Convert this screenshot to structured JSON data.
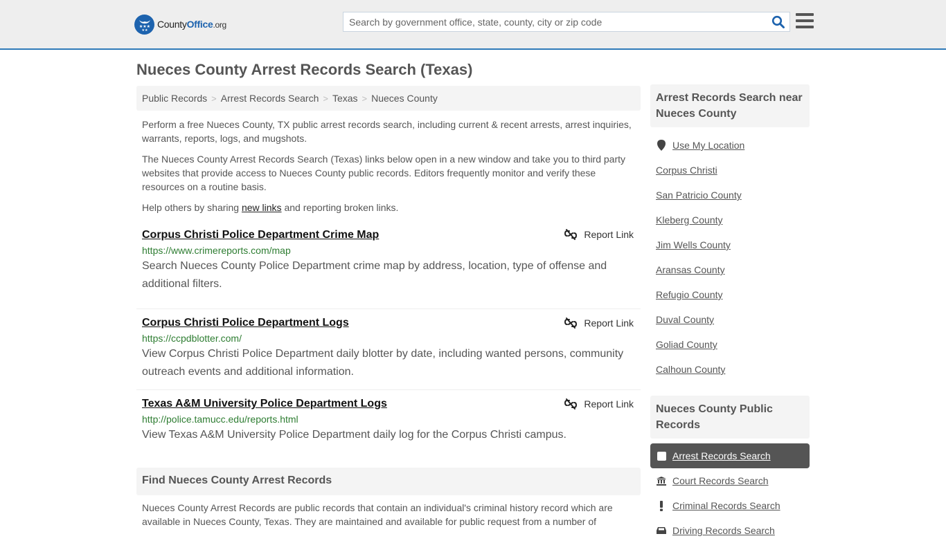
{
  "header": {
    "logo": {
      "brand_a": "County",
      "brand_b": "Office",
      "brand_c": ".org"
    },
    "search": {
      "placeholder": "Search by government office, state, county, city or zip code",
      "value": ""
    },
    "icons": {
      "search": "search-icon",
      "menu": "hamburger-menu-icon"
    }
  },
  "page": {
    "title": "Nueces County Arrest Records Search (Texas)"
  },
  "breadcrumb": [
    {
      "label": "Public Records"
    },
    {
      "label": "Arrest Records Search"
    },
    {
      "label": "Texas"
    },
    {
      "label": "Nueces County"
    }
  ],
  "breadcrumb_separator": ">",
  "intro": {
    "p1": "Perform a free Nueces County, TX public arrest records search, including current & recent arrests, arrest inquiries, warrants, reports, logs, and mugshots.",
    "p2": "The Nueces County Arrest Records Search (Texas) links below open in a new window and take you to third party websites that provide access to Nueces County public records. Editors frequently monitor and verify these resources on a routine basis.",
    "p3_before": "Help others by sharing ",
    "p3_link": "new links",
    "p3_after": " and reporting broken links."
  },
  "results": [
    {
      "title": "Corpus Christi Police Department Crime Map",
      "url": "https://www.crimereports.com/map",
      "description": "Search Nueces County Police Department crime map by address, location, type of offense and additional filters.",
      "report_label": "Report Link"
    },
    {
      "title": "Corpus Christi Police Department Logs",
      "url": "https://ccpdblotter.com/",
      "description": "View Corpus Christi Police Department daily blotter by date, including wanted persons, community outreach events and additional information.",
      "report_label": "Report Link"
    },
    {
      "title": "Texas A&M University Police Department Logs",
      "url": "http://police.tamucc.edu/reports.html",
      "description": "View Texas A&M University Police Department daily log for the Corpus Christi campus.",
      "report_label": "Report Link"
    }
  ],
  "find": {
    "heading": "Find Nueces County Arrest Records",
    "text": "Nueces County Arrest Records are public records that contain an individual's criminal history record which are available in Nueces County, Texas. They are maintained and available for public request from a number of"
  },
  "sidebar": {
    "nearby": {
      "heading": "Arrest Records Search near Nueces County",
      "location_label": "Use My Location",
      "items": [
        {
          "label": "Corpus Christi"
        },
        {
          "label": "San Patricio County"
        },
        {
          "label": "Kleberg County"
        },
        {
          "label": "Jim Wells County"
        },
        {
          "label": "Aransas County"
        },
        {
          "label": "Refugio County"
        },
        {
          "label": "Duval County"
        },
        {
          "label": "Goliad County"
        },
        {
          "label": "Calhoun County"
        }
      ]
    },
    "public_records": {
      "heading": "Nueces County Public Records",
      "items": [
        {
          "label": "Arrest Records Search",
          "icon": "square-icon",
          "active": true
        },
        {
          "label": "Court Records Search",
          "icon": "courthouse-icon",
          "active": false
        },
        {
          "label": "Criminal Records Search",
          "icon": "exclamation-icon",
          "active": false
        },
        {
          "label": "Driving Records Search",
          "icon": "car-icon",
          "active": false
        }
      ]
    }
  },
  "colors": {
    "brand_blue": "#1d63ae",
    "header_border": "#2f7ab8",
    "url_green": "#2e7d32",
    "active_bg": "#555555"
  }
}
